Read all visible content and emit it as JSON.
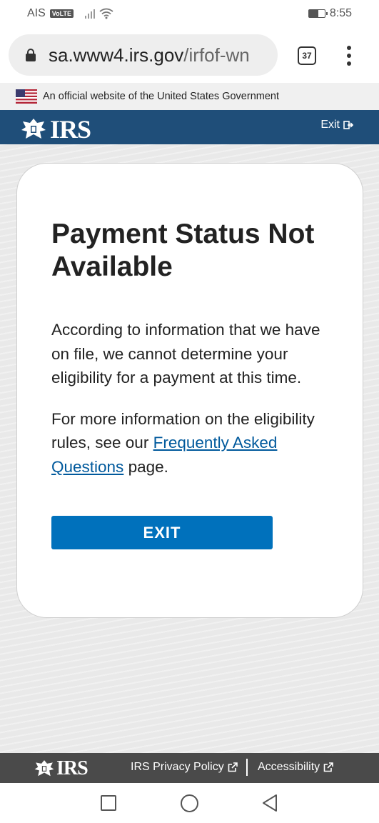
{
  "status_bar": {
    "carrier": "AIS",
    "network_badge": "VoLTE",
    "time": "8:55",
    "battery_level": 0.6,
    "icons": [
      "signal-icon",
      "wifi-icon",
      "battery-icon"
    ]
  },
  "browser": {
    "url_domain": "sa.www4.irs.gov",
    "url_path": "/irfof-wn",
    "tab_count": "37",
    "icons": [
      "lock-icon",
      "more-vert-icon"
    ]
  },
  "gov_banner": {
    "text": "An official website of the United States Government",
    "icon": "us-flag-icon"
  },
  "header": {
    "logo_text": "IRS",
    "exit_label": "Exit",
    "colors": {
      "background": "#1f4e79"
    }
  },
  "card": {
    "title": "Payment Status Not Available",
    "paragraph1": "According to information that we have on file, we cannot determine your eligibility for a payment at this time.",
    "paragraph2_before": "For more information on the eligibility rules, see our ",
    "paragraph2_link": "Frequently Asked Questions",
    "paragraph2_after": " page.",
    "button_label": "EXIT",
    "colors": {
      "button": "#0071bc",
      "link": "#00599c"
    }
  },
  "footer": {
    "logo_text": "IRS",
    "privacy_label": "IRS Privacy Policy",
    "accessibility_label": "Accessibility",
    "icons": [
      "external-link-icon"
    ]
  },
  "nav_bar": {
    "icons": [
      "recent-apps-icon",
      "home-icon",
      "back-icon"
    ]
  }
}
